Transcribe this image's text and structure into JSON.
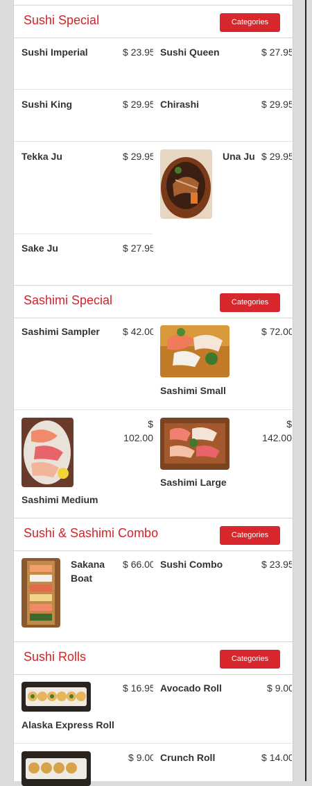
{
  "categories_label": "Categories",
  "currency": "$",
  "sections": {
    "sushi_special": {
      "title": "Sushi Special",
      "items": [
        {
          "name": "Sushi Imperial",
          "price": "23.95"
        },
        {
          "name": "Sushi Queen",
          "price": "27.95"
        },
        {
          "name": "Sushi King",
          "price": "29.95"
        },
        {
          "name": "Chirashi",
          "price": "29.95"
        },
        {
          "name": "Tekka Ju",
          "price": "29.95"
        },
        {
          "name": "Una Ju",
          "price": "29.95"
        },
        {
          "name": "Sake Ju",
          "price": "27.95"
        }
      ]
    },
    "sashimi_special": {
      "title": "Sashimi Special",
      "items": [
        {
          "name": "Sashimi Sampler",
          "price": "42.00"
        },
        {
          "name": "Sashimi Small",
          "price": "72.00"
        },
        {
          "name": "Sashimi Medium",
          "price": "102.00"
        },
        {
          "name": "Sashimi Large",
          "price": "142.00"
        }
      ]
    },
    "combo": {
      "title": "Sushi & Sashimi Combo",
      "items": [
        {
          "name": "Sakana Boat",
          "price": "66.00"
        },
        {
          "name": "Sushi Combo",
          "price": "23.95"
        }
      ]
    },
    "rolls": {
      "title": "Sushi Rolls",
      "items": [
        {
          "name": "Alaska Express Roll",
          "price": "16.95"
        },
        {
          "name": "Avocado Roll",
          "price": "9.00"
        },
        {
          "name": "",
          "price": "9.00"
        },
        {
          "name": "Crunch Roll",
          "price": "14.00"
        }
      ]
    }
  },
  "colors": {
    "accent": "#d7262c",
    "title": "#d0242b",
    "background": "#dcdcdc"
  }
}
